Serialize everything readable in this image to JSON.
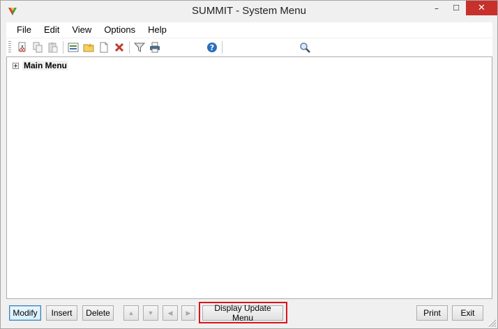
{
  "window": {
    "title": "SUMMIT - System Menu",
    "app_icon": "summit-logo-icon",
    "controls": {
      "minimize": "–",
      "maximize": "☐",
      "close": "✕"
    }
  },
  "menubar": {
    "items": [
      "File",
      "Edit",
      "View",
      "Options",
      "Help"
    ]
  },
  "toolbar": {
    "icons": [
      "cut-icon",
      "copy-icon",
      "paste-icon",
      "properties-icon",
      "new-folder-icon",
      "new-document-icon",
      "delete-icon",
      "filter-icon",
      "print-icon",
      "help-icon",
      "search-icon"
    ],
    "search_value": ""
  },
  "tree": {
    "root_label": "Main Menu"
  },
  "buttons": {
    "modify": "Modify",
    "insert": "Insert",
    "delete": "Delete",
    "move_up": "▲",
    "move_down": "▼",
    "move_left": "◀",
    "move_right": "▶",
    "display_update_menu": "Display Update Menu",
    "print": "Print",
    "exit": "Exit"
  },
  "colors": {
    "close_button": "#c7302b",
    "highlight_box": "#d9151b",
    "help_icon": "#2a6ebd",
    "delete_icon": "#c0392b"
  }
}
